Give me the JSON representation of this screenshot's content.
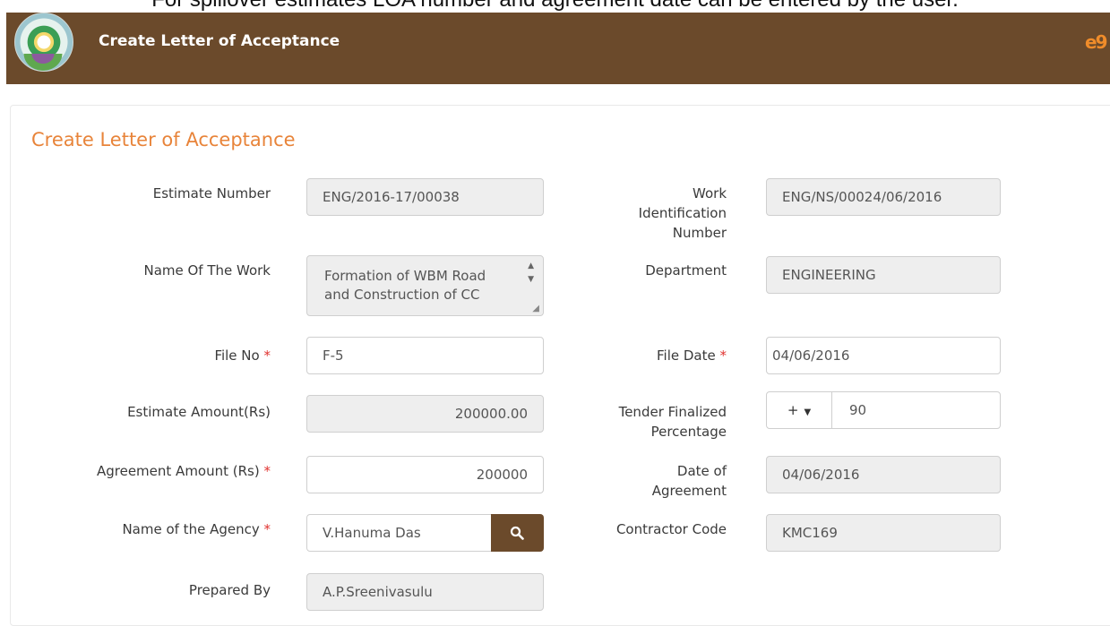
{
  "caption": "For spillover estimates LOA number and agreement date can be entered by the user.",
  "header": {
    "title": "Create Letter of Acceptance",
    "brand_icon_text": "e9"
  },
  "form": {
    "title": "Create Letter of Acceptance",
    "estimate_number": {
      "label": "Estimate Number",
      "value": "ENG/2016-17/00038"
    },
    "work_identification": {
      "label_line1": "Work",
      "label_line2": "Identification",
      "label_line3": "Number",
      "value": "ENG/NS/00024/06/2016"
    },
    "name_of_work": {
      "label": "Name Of The Work",
      "value": "Formation of WBM Road and Construction of CC"
    },
    "department": {
      "label": "Department",
      "value": "ENGINEERING"
    },
    "file_no": {
      "label": "File No",
      "required": "*",
      "value": "F-5"
    },
    "file_date": {
      "label": "File Date",
      "required": "*",
      "value": "04/06/2016"
    },
    "estimate_amount": {
      "label": "Estimate Amount(Rs)",
      "value": "200000.00"
    },
    "tender_percentage": {
      "label_line1": "Tender Finalized",
      "label_line2": "Percentage",
      "sign": "+",
      "value": "90"
    },
    "agreement_amount": {
      "label": "Agreement Amount (Rs)",
      "required": "*",
      "value": "200000"
    },
    "date_of_agreement": {
      "label_line1": "Date of",
      "label_line2": "Agreement",
      "value": "04/06/2016"
    },
    "agency": {
      "label": "Name of the Agency",
      "required": "*",
      "value": "V.Hanuma Das"
    },
    "contractor_code": {
      "label": "Contractor Code",
      "value": "KMC169"
    },
    "prepared_by": {
      "label": "Prepared By",
      "value": "A.P.Sreenivasulu"
    }
  },
  "colors": {
    "header_bg": "#6b4a2b",
    "title_accent": "#e8843a",
    "required": "#e0322f",
    "readonly_bg": "#eeeeee"
  },
  "icons": {
    "logo": "state-emblem-logo",
    "brand": "egov-brand-icon",
    "search": "search-icon",
    "sign_caret": "caret-down-icon"
  }
}
